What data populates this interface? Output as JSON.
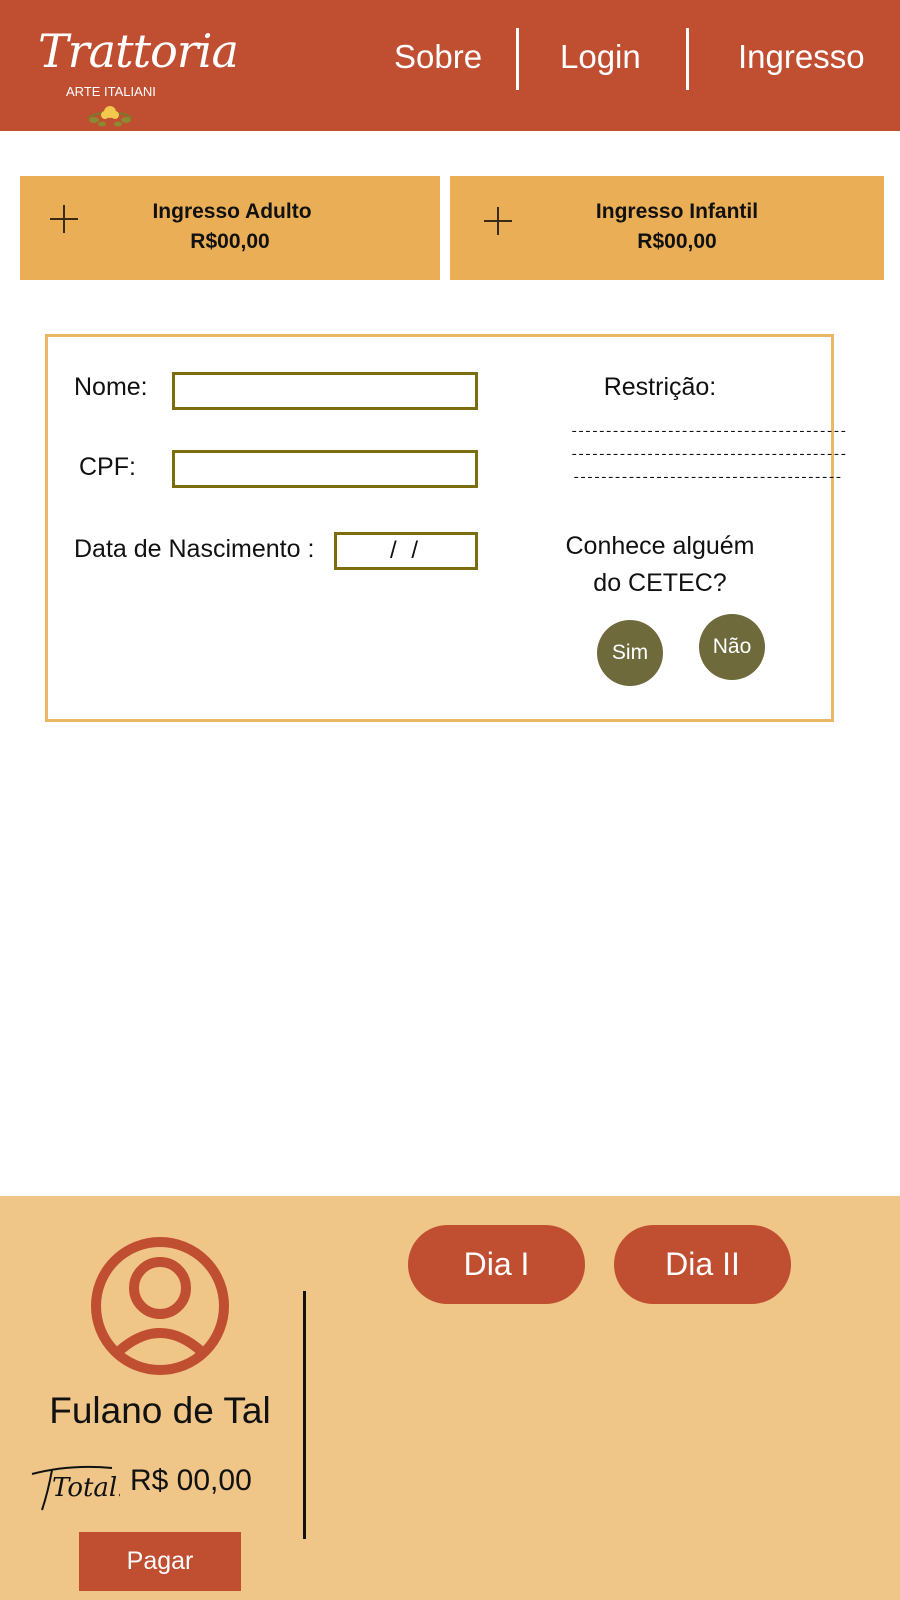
{
  "header": {
    "logo": {
      "script_text": "Trattoria",
      "subtitle": "ARTE ITALIANI"
    },
    "nav": [
      {
        "label": "Sobre"
      },
      {
        "label": "Login"
      },
      {
        "label": "Ingresso"
      }
    ]
  },
  "tickets": [
    {
      "name": "Ingresso Adulto",
      "price": "R$00,00",
      "icon": "plus-icon"
    },
    {
      "name": "Ingresso Infantil",
      "price": "R$00,00",
      "icon": "plus-icon"
    }
  ],
  "form": {
    "name_label": "Nome:",
    "name_value": "",
    "cpf_label": "CPF:",
    "cpf_value": "",
    "birth_label": "Data de Nascimento :",
    "birth_value": " /  /",
    "restriction_label": "Restrição:",
    "restriction_lines": [
      "----------------------------------------",
      "----------------------------------------",
      "---------------------------------------"
    ],
    "cetec_question_line1": "Conhece alguém",
    "cetec_question_line2": "do CETEC?",
    "yes_label": "Sim",
    "no_label": "Não"
  },
  "footer": {
    "user_name": "Fulano de Tal",
    "total_label": "Total:",
    "total_value": "R$ 00,00",
    "pay_label": "Pagar",
    "days": [
      {
        "label": "Dia I"
      },
      {
        "label": "Dia II"
      }
    ]
  },
  "colors": {
    "header_bg": "#c04e31",
    "ticket_bg": "#eaaf56",
    "card_border": "#eab767",
    "field_border": "#7c6e0e",
    "round_button": "#6e6a3c",
    "footer_bg": "#efc588",
    "accent": "#c04e31"
  }
}
